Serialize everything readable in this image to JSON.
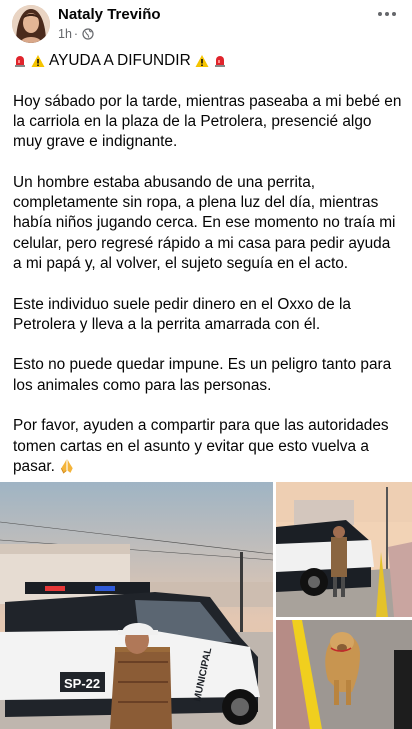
{
  "post": {
    "author": "Nataly Treviño",
    "time": "1h",
    "title": "AYUDA A DIFUNDIR",
    "paragraphs": [
      "Hoy sábado por la tarde, mientras paseaba a mi bebé en la carriola en la plaza de la Petrolera, presencié algo muy grave e indignante.",
      "Un hombre estaba abusando de una perrita, completamente sin ropa, a plena luz del día, mientras había niños jugando cerca. En ese momento no traía mi celular, pero regresé rápido a mi casa para pedir ayuda a mi papá y, al volver, el sujeto seguía en el acto.",
      "Este individuo suele pedir dinero en el Oxxo de la Petrolera y lleva a la perrita amarrada con él.",
      "Esto no puede quedar impune. Es un peligro tanto para los animales como para las personas.",
      "Por favor, ayuden a compartir para que las autoridades tomen cartas en el asunto y evitar que esto vuelva a pasar."
    ],
    "truck_plate": "SP-22",
    "truck_label": "MUNICIPAL"
  },
  "icons": {
    "title_left": [
      "siren-icon",
      "warning-icon"
    ],
    "title_right": [
      "warning-icon",
      "siren-icon"
    ],
    "closing": "praying-hands-icon",
    "audience": "globe-icon",
    "menu": "more-options-icon"
  },
  "colors": {
    "secondary_text": "#65676b",
    "text": "#050505"
  }
}
